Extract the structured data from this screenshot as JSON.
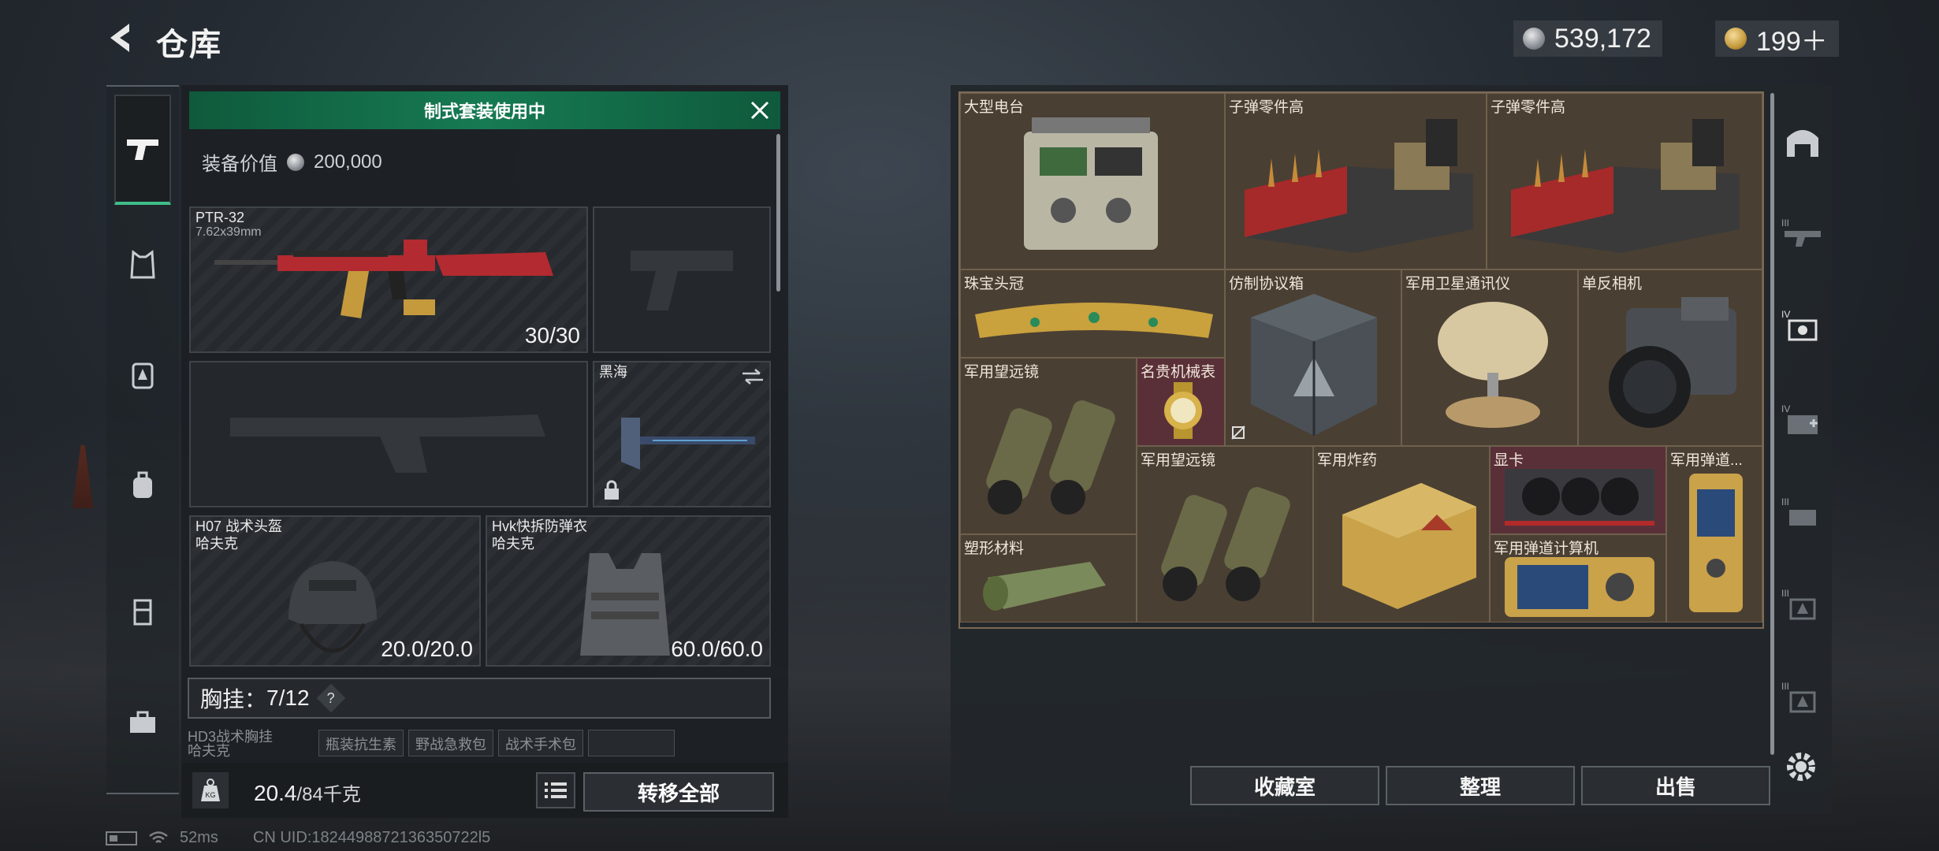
{
  "header": {
    "title": "仓库",
    "silver_amount": "539,172",
    "gold_amount": "199＋"
  },
  "loadout": {
    "set_banner": "制式套装使用中",
    "value_label": "装备价值",
    "value_amount": "200,000",
    "primary_weapon": {
      "name": "PTR-32",
      "caliber": "7.62x39mm",
      "ammo": "30/30"
    },
    "melee": {
      "name": "黑海"
    },
    "helmet": {
      "name": "H07 战术头盔",
      "brand": "哈夫克",
      "durability": "20.0/20.0"
    },
    "armor": {
      "name": "Hvk快拆防弹衣",
      "brand": "哈夫克",
      "durability": "60.0/60.0"
    },
    "chest_rig": {
      "label": "胸挂：",
      "capacity": "7/12",
      "help": "?"
    },
    "chest_items": [
      "HD3战术胸挂",
      "瓶装抗生素",
      "野战急救包",
      "战术手术包",
      ""
    ],
    "chest_sub": "哈夫克",
    "weight_current": "20.4",
    "weight_max": "/84千克",
    "kg_label": "KG",
    "transfer_all": "转移全部"
  },
  "storage": {
    "items": [
      "大型电台",
      "子弹零件高",
      "子弹零件高",
      "珠宝头冠",
      "仿制协议箱",
      "军用卫星通讯仪",
      "单反相机",
      "军用望远镜",
      "名贵机械表",
      "军用望远镜",
      "军用炸药",
      "显卡",
      "军用弹道...",
      "塑形材料",
      "军用弹道计算机"
    ],
    "buttons": {
      "collection": "收藏室",
      "organize": "整理",
      "sell": "出售"
    }
  },
  "right_nav_levels": [
    "",
    "III",
    "IV",
    "IV",
    "III",
    "III",
    "III"
  ],
  "status": {
    "ping": "52ms",
    "uid": "CN UID:1824498872136350722l5"
  },
  "colors": {
    "accent_green": "#167a52",
    "cell_brown": "#4a3f33",
    "cell_red": "#5a3038"
  }
}
